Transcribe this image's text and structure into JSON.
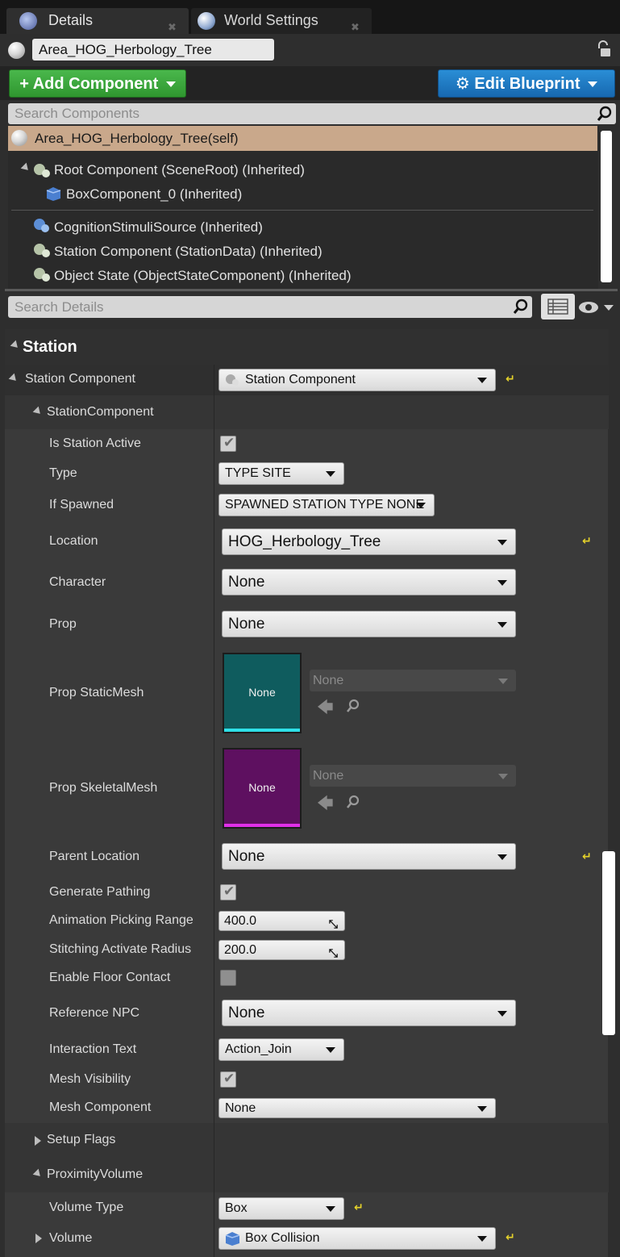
{
  "tabs": [
    {
      "label": "Details",
      "active": true
    },
    {
      "label": "World Settings",
      "active": false
    }
  ],
  "actor_name": "Area_HOG_Herbology_Tree",
  "toolbar": {
    "add_component": "Add Component",
    "edit_blueprint": "Edit Blueprint"
  },
  "search_components": {
    "placeholder": "Search Components"
  },
  "component_tree": {
    "self": "Area_HOG_Herbology_Tree(self)",
    "items": [
      "Root Component (SceneRoot) (Inherited)",
      "BoxComponent_0 (Inherited)",
      "CognitionStimuliSource (Inherited)",
      "Station Component (StationData) (Inherited)",
      "Object State (ObjectStateComponent) (Inherited)"
    ]
  },
  "search_details": {
    "placeholder": "Search Details"
  },
  "details": {
    "category": "Station",
    "station_component_label": "Station Component",
    "station_component_value": "Station Component",
    "group_label": "StationComponent",
    "props": {
      "is_station_active": {
        "label": "Is Station Active",
        "checked": true
      },
      "type": {
        "label": "Type",
        "value": "TYPE SITE"
      },
      "if_spawned": {
        "label": "If Spawned",
        "value": "SPAWNED STATION TYPE NONE"
      },
      "location": {
        "label": "Location",
        "value": "HOG_Herbology_Tree"
      },
      "character": {
        "label": "Character",
        "value": "None"
      },
      "prop": {
        "label": "Prop",
        "value": "None"
      },
      "prop_staticmesh": {
        "label": "Prop StaticMesh",
        "thumb": "None",
        "value": "None"
      },
      "prop_skeletalmesh": {
        "label": "Prop SkeletalMesh",
        "thumb": "None",
        "value": "None"
      },
      "parent_location": {
        "label": "Parent Location",
        "value": "None"
      },
      "generate_pathing": {
        "label": "Generate Pathing",
        "checked": true
      },
      "animation_picking_range": {
        "label": "Animation Picking Range",
        "value": "400.0"
      },
      "stitching_activate_radius": {
        "label": "Stitching Activate Radius",
        "value": "200.0"
      },
      "enable_floor_contact": {
        "label": "Enable Floor Contact",
        "checked": false
      },
      "reference_npc": {
        "label": "Reference NPC",
        "value": "None"
      },
      "interaction_text": {
        "label": "Interaction Text",
        "value": "Action_Join"
      },
      "mesh_visibility": {
        "label": "Mesh Visibility",
        "checked": true
      },
      "mesh_component": {
        "label": "Mesh Component",
        "value": "None"
      }
    },
    "setup_flags": "Setup Flags",
    "proximity_volume": "ProximityVolume",
    "volume_type": {
      "label": "Volume Type",
      "value": "Box"
    },
    "volume": {
      "label": "Volume",
      "value": "Box Collision"
    }
  },
  "colors": {
    "add_component": "#3aa83c",
    "edit_blueprint": "#1f7cc4",
    "self_row": "#c9a88b",
    "staticmesh_thumb": "#0f5c5e",
    "skeletalmesh_thumb": "#5e1060",
    "reset_arrow": "#e6d32a"
  },
  "icons": [
    "details-icon",
    "world-icon",
    "lock-icon",
    "search-icon",
    "gear-icon",
    "view-options-icon",
    "eye-icon",
    "reset-arrow-icon",
    "browse-arrow-icon",
    "find-icon"
  ]
}
